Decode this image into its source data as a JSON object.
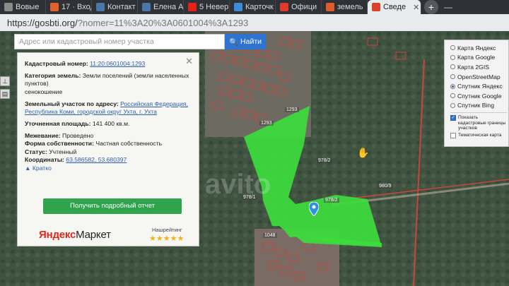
{
  "browser": {
    "tabs": [
      {
        "label": "Вовыe",
        "color": "#8a8a8a"
      },
      {
        "label": "17 · Вход",
        "color": "#e0622a"
      },
      {
        "label": "Контакт",
        "color": "#4a76a8"
      },
      {
        "label": "Елена Ан",
        "color": "#4a76a8"
      },
      {
        "label": "5 Невер",
        "color": "#e62117"
      },
      {
        "label": "Карточк",
        "color": "#3d8bd8"
      },
      {
        "label": "Офици",
        "color": "#e03a2e"
      },
      {
        "label": "земель",
        "color": "#e05a2a"
      },
      {
        "label": "Сведе",
        "color": "#d9412a"
      }
    ],
    "url_host": "https://gosbti.org/",
    "url_path": "?nomer=11%3A20%3A0601004%3A1293"
  },
  "search": {
    "placeholder": "Адрес или кадастровый номер участка",
    "button_label": "Найти"
  },
  "info_panel": {
    "cadastral_label": "Кадастровый номер:",
    "cadastral_value": "11:20:0601004:1293",
    "category_label": "Категория земель:",
    "category_value": "Земли поселений (земли населенных пунктов)",
    "usage": "сенокошение",
    "address_label": "Земельный участок по адресу:",
    "address_value": "Российская Федерация, Республика Коми, городской округ Ухта, г. Ухта",
    "area_label": "Уточненная площадь:",
    "area_value": "141 400 кв.м.",
    "survey_label": "Межевание:",
    "survey_value": "Проведено",
    "ownership_label": "Форма собственности:",
    "ownership_value": "Частная собственность",
    "status_label": "Статус:",
    "status_value": "Учтенный",
    "coords_label": "Координаты:",
    "coords_value": "63.586582, 53.680397",
    "collapse_label": "Кратко",
    "report_button": "Получить подробный отчет",
    "market_brand_y": "Яндекс",
    "market_brand_m": "Маркет",
    "rating_label": "Нашрейтинг",
    "rating": 5
  },
  "layers": {
    "options": [
      {
        "label": "Карта Яндекс",
        "selected": false
      },
      {
        "label": "Карта Google",
        "selected": false
      },
      {
        "label": "Карта 2GIS",
        "selected": false
      },
      {
        "label": "OpenStreetMap",
        "selected": false
      },
      {
        "label": "Спутник Яндекс",
        "selected": true
      },
      {
        "label": "Спутник Google",
        "selected": false
      },
      {
        "label": "Спутник Bing",
        "selected": false
      }
    ],
    "show_boundaries": "Показать кадастровые границы участков",
    "thematic_map": "Тематическая карта"
  },
  "map_labels": {
    "parcel_a": "1293",
    "parcel_b": "1293",
    "plot_978_1": "978/1",
    "plot_978_2": "978/2",
    "plot_978_3": "978/2",
    "plot_980": "980/9",
    "plot_1048": "1048",
    "watermark": "avito"
  },
  "colors": {
    "parcel_fill": "#3ddc3d",
    "accent_blue": "#2f73d1",
    "report_green": "#2fa44c"
  }
}
